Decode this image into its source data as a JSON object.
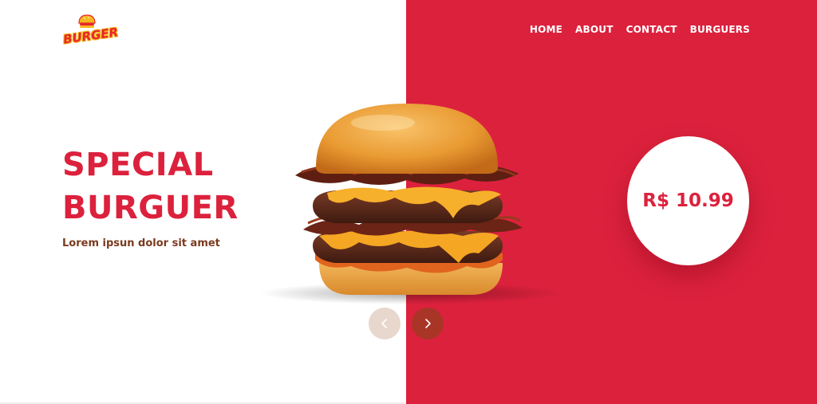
{
  "logo": {
    "text": "BURGER",
    "icon": "burger-logo-icon"
  },
  "nav": {
    "items": [
      {
        "label": "HOME"
      },
      {
        "label": "ABOUT"
      },
      {
        "label": "CONTACT"
      },
      {
        "label": "BURGUERS"
      }
    ]
  },
  "hero": {
    "title_line1": "SPECIAL",
    "title_line2": "BURGUER",
    "subtitle": "Lorem ipsun dolor sit amet",
    "image": "burger-image"
  },
  "price": {
    "text": "R$ 10.99"
  },
  "carousel": {
    "prev_icon": "chevron-left-icon",
    "next_icon": "chevron-right-icon"
  },
  "colors": {
    "accent": "#dc213d",
    "subtitle": "#7a3a1e",
    "prev_button": "#e8d7cc",
    "next_button": "#a93526",
    "background": "#ffffff"
  }
}
